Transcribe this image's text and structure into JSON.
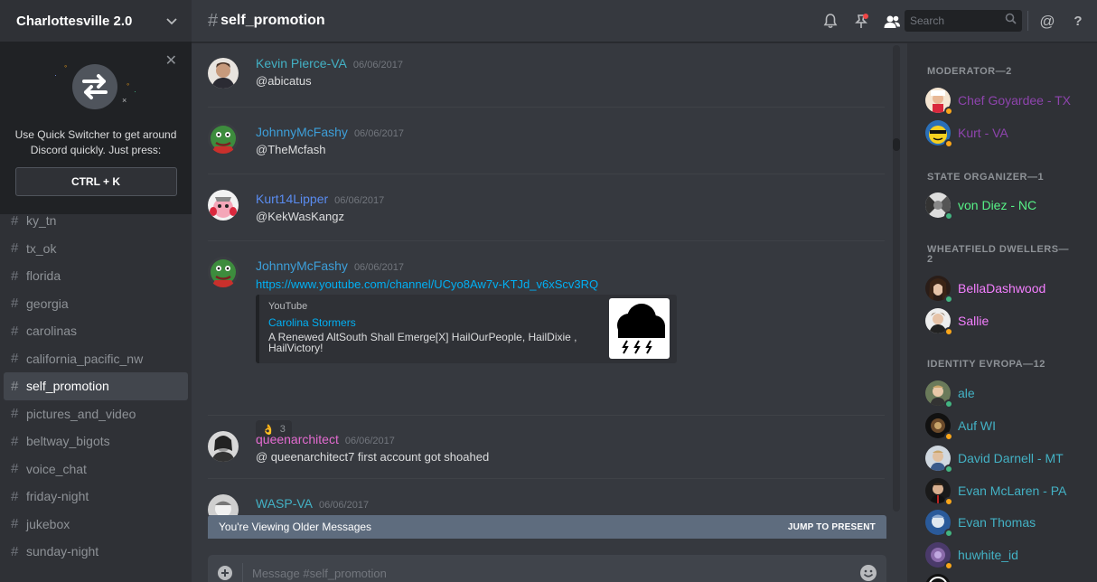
{
  "server": {
    "name": "Charlottesville 2.0",
    "chevron_icon": "chevron-down-icon"
  },
  "switcher": {
    "text_line1": "Use Quick Switcher to get around",
    "text_line2": "Discord quickly. Just press:",
    "shortcut": "CTRL + K",
    "close_glyph": "✕"
  },
  "channels": [
    {
      "name": "ky_tn"
    },
    {
      "name": "tx_ok"
    },
    {
      "name": "florida"
    },
    {
      "name": "georgia"
    },
    {
      "name": "carolinas"
    },
    {
      "name": "california_pacific_nw"
    },
    {
      "name": "self_promotion"
    },
    {
      "name": "pictures_and_video"
    },
    {
      "name": "beltway_bigots"
    },
    {
      "name": "voice_chat"
    },
    {
      "name": "friday-night"
    },
    {
      "name": "jukebox"
    },
    {
      "name": "sunday-night"
    }
  ],
  "hash": "#",
  "header": {
    "channel": "self_promotion",
    "search_placeholder": "Search"
  },
  "messages": [
    {
      "author": "Kevin Pierce-VA",
      "color": "#43b1c4",
      "time": "06/06/2017",
      "text": "@abicatus"
    },
    {
      "author": "JohnnyMcFashy",
      "color": "#3d9fd9",
      "time": "06/06/2017",
      "text": "@TheMcfash"
    },
    {
      "author": "Kurt14Lipper",
      "color": "#5a8cf0",
      "time": "06/06/2017",
      "text": "@KekWasKangz"
    },
    {
      "author": "JohnnyMcFashy",
      "color": "#3d9fd9",
      "time": "06/06/2017",
      "text": "https://www.youtube.com/channel/UCyo8Aw7v-KTJd_v6xScv3RQ"
    },
    {
      "author": "queenarchitect",
      "color": "#e36bd0",
      "time": "06/06/2017",
      "text": "@ queenarchitect7   first account got shoahed"
    },
    {
      "author": "WASP-VA",
      "color": "#43b1c4",
      "time": "06/06/2017",
      "text": ""
    }
  ],
  "embed": {
    "provider": "YouTube",
    "title": "Carolina Stormers",
    "description": "A Renewed AltSouth Shall Emerge[X] HailOurPeople, HailDixie , HailVictory!"
  },
  "reaction": {
    "emoji": "👌",
    "count": "3"
  },
  "older_bar": {
    "text": "You're Viewing Older Messages",
    "jump": "JUMP TO PRESENT"
  },
  "composer": {
    "placeholder": "Message #self_promotion",
    "plus": "+"
  },
  "members": {
    "roles": [
      {
        "title": "MODERATOR—2"
      },
      {
        "title": "STATE ORGANIZER—1"
      },
      {
        "title": "WHEATFIELD DWELLERS—2"
      },
      {
        "title": "IDENTITY EVROPA—12"
      }
    ],
    "list": [
      {
        "name": "Chef Goyardee - TX",
        "color": "#8e44ad",
        "status": "#faa61a"
      },
      {
        "name": "Kurt - VA",
        "color": "#8e44ad",
        "status": "#faa61a"
      },
      {
        "name": "von Diez - NC",
        "color": "#57f287",
        "status": "#43b581"
      },
      {
        "name": "BellaDashwood",
        "color": "#f47fff",
        "status": "#43b581"
      },
      {
        "name": "Sallie",
        "color": "#f47fff",
        "status": "#faa61a"
      },
      {
        "name": "ale",
        "color": "#43b1c4",
        "status": "#43b581"
      },
      {
        "name": "Auf WI",
        "color": "#43b1c4",
        "status": "#faa61a"
      },
      {
        "name": "David Darnell - MT",
        "color": "#43b1c4",
        "status": "#43b581"
      },
      {
        "name": "Evan McLaren - PA",
        "color": "#43b1c4",
        "status": "#faa61a"
      },
      {
        "name": "Evan Thomas",
        "color": "#43b1c4",
        "status": "#43b581"
      },
      {
        "name": "huwhite_id",
        "color": "#43b1c4",
        "status": "#faa61a"
      }
    ]
  }
}
